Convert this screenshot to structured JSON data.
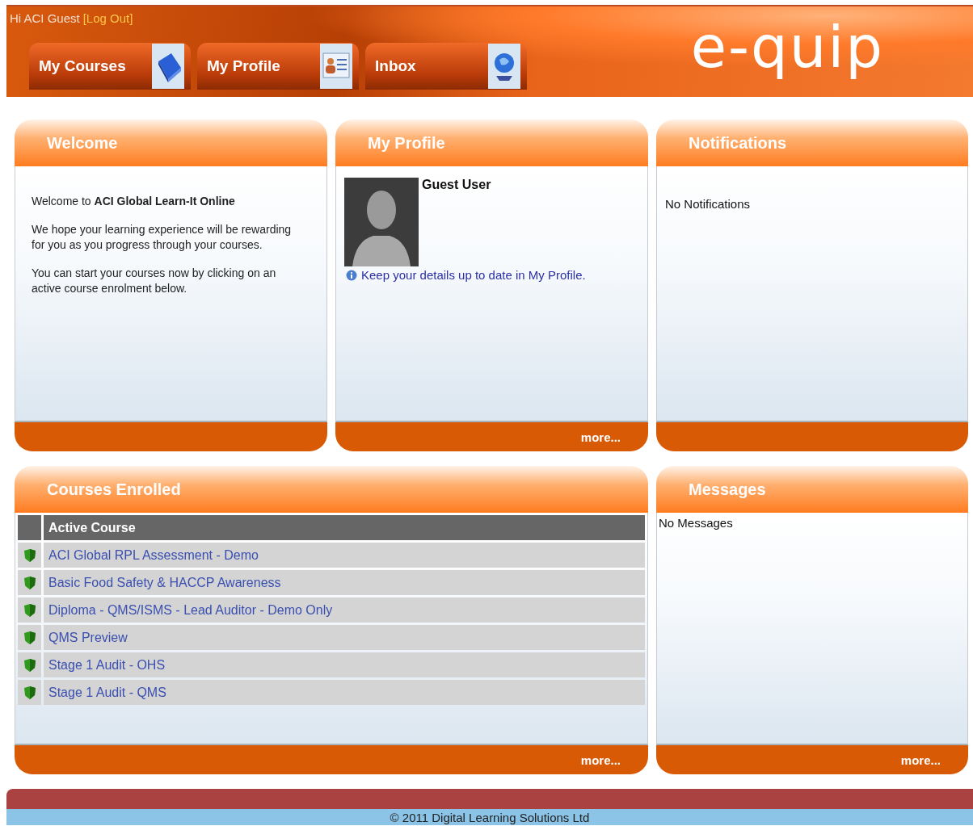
{
  "header": {
    "greeting": "Hi ACI Guest",
    "logout": "[Log Out]",
    "logo": "e-quip"
  },
  "tabs": [
    {
      "label": "My Courses"
    },
    {
      "label": "My Profile"
    },
    {
      "label": "Inbox"
    }
  ],
  "welcome": {
    "title": "Welcome",
    "paragraphs": [
      "Welcome to **ACI Global Learn-It Online**",
      "We hope your learning experience will be rewarding for you as you progress through your courses.",
      "You can start your courses now by clicking on an active course enrolment below."
    ]
  },
  "profile": {
    "title": "My Profile",
    "name": "Guest User",
    "link": "Keep your details up to date in My Profile.",
    "more": "more..."
  },
  "notifications": {
    "title": "Notifications",
    "text": "No Notifications"
  },
  "courses": {
    "title": "Courses Enrolled",
    "column": "Active Course",
    "rows": [
      "ACI Global RPL Assessment - Demo",
      "Basic Food Safety & HACCP Awareness",
      "Diploma - QMS/ISMS - Lead Auditor - Demo Only",
      "QMS Preview",
      "Stage 1 Audit - OHS",
      "Stage 1 Audit - QMS"
    ],
    "more": "more..."
  },
  "messages": {
    "title": "Messages",
    "text": "No Messages",
    "more": "more..."
  },
  "footer": {
    "text": "© 2011 Digital Learning Solutions Ltd"
  }
}
